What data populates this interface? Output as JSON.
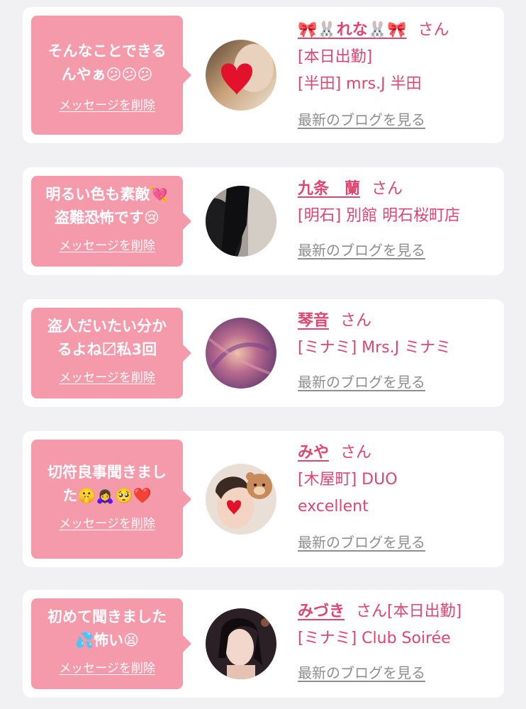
{
  "colors": {
    "accent": "#e0456f",
    "bubble": "#f59aab",
    "link_gray": "#8e8e8e",
    "page_bg": "#f1f1f3",
    "card_bg": "#ffffff"
  },
  "cards": [
    {
      "message": "そんなことできる\nんやぁ😕😕😕",
      "delete_label": "メッセージを削除",
      "name": "🎀🐰れな🐰🎀",
      "honorific": "さん",
      "lines": [
        "[本日出勤]",
        "[半田] mrs.J 半田"
      ],
      "blog_link": "最新のブログを見る",
      "avatar_icon": "heart-sticker-photo"
    },
    {
      "message": "明るい色も素敵💘\n盗難恐怖です😢",
      "delete_label": "メッセージを削除",
      "name": "九条　蘭",
      "honorific": "さん",
      "lines": [
        "[明石] 別館 明石桜町店"
      ],
      "blog_link": "最新のブログを見る",
      "avatar_icon": "dark-portrait-photo"
    },
    {
      "message": "盗人だいたい分か\nるよね〼私3回",
      "delete_label": "メッセージを削除",
      "name": "琴音",
      "honorific": "さん",
      "lines": [
        "[ミナミ] Mrs.J ミナミ"
      ],
      "blog_link": "最新のブログを見る",
      "avatar_icon": "purple-blur-photo"
    },
    {
      "message": "切符良事聞きまし\nた🤫🙇‍♀️🥺❤️",
      "delete_label": "メッセージを削除",
      "name": "みや",
      "honorific": "さん",
      "lines": [
        "[木屋町] DUO",
        "excellent"
      ],
      "blog_link": "最新のブログを見る",
      "avatar_icon": "bear-sticker-photo"
    },
    {
      "message": "初めて聞きました\n💦怖い😫",
      "delete_label": "メッセージを削除",
      "name": "みづき",
      "honorific": "さん[本日出勤]",
      "lines": [
        "[ミナミ] Club Soirée"
      ],
      "blog_link": "最新のブログを見る",
      "avatar_icon": "portrait-photo"
    }
  ]
}
